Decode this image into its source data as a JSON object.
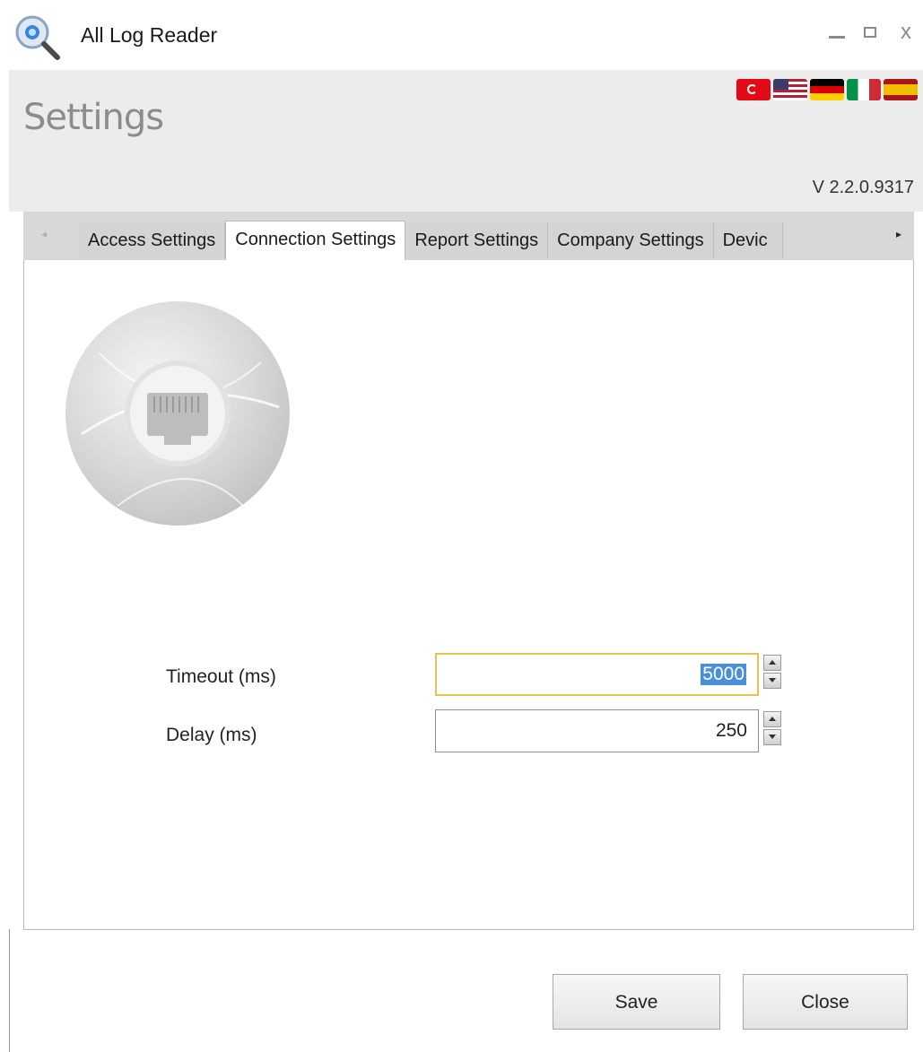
{
  "window": {
    "title": "All Log Reader",
    "controls": {
      "minimize": "–",
      "maximize": "□",
      "close": "x"
    }
  },
  "header": {
    "title": "Settings",
    "version": "V 2.2.0.9317",
    "languages": [
      "tr",
      "us",
      "de",
      "it",
      "es"
    ]
  },
  "tabs": {
    "items": [
      {
        "label": "Access Settings",
        "active": false
      },
      {
        "label": "Connection Settings",
        "active": true
      },
      {
        "label": "Report Settings",
        "active": false
      },
      {
        "label": "Company Settings",
        "active": false
      },
      {
        "label": "Devic",
        "active": false
      }
    ],
    "scroll_left": "◂",
    "scroll_right": "▸"
  },
  "connection": {
    "icon": "network-globe-icon",
    "timeout": {
      "label": "Timeout (ms)",
      "value": "5000"
    },
    "delay": {
      "label": "Delay (ms)",
      "value": "250"
    }
  },
  "buttons": {
    "save": "Save",
    "close": "Close"
  },
  "colors": {
    "header_bg": "#ececec",
    "tab_strip_bg": "#d8d8d8",
    "focus_border": "#e6c64a",
    "selection": "#4a90d9"
  }
}
